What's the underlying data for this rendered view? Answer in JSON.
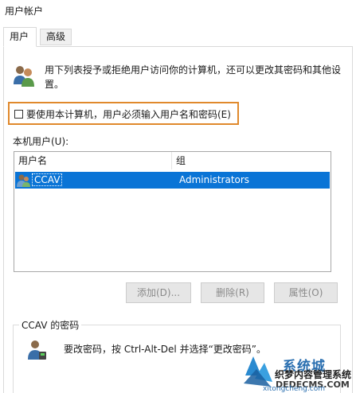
{
  "window": {
    "title": "用户帐户"
  },
  "tabs": [
    {
      "label": "用户"
    },
    {
      "label": "高级"
    }
  ],
  "description": "用下列表授予或拒绝用户访问你的计算机，还可以更改其密码和其他设置。",
  "require_login_checkbox": {
    "label": "要使用本计算机，用户必须输入用户名和密码(E)",
    "checked": false
  },
  "users_list": {
    "label": "本机用户(U):",
    "columns": [
      "用户名",
      "组"
    ],
    "rows": [
      {
        "name": "CCAV",
        "group": "Administrators",
        "selected": true
      }
    ]
  },
  "buttons": {
    "add": "添加(D)...",
    "remove": "删除(R)",
    "properties": "属性(O)"
  },
  "password_group": {
    "title": "CCAV 的密码",
    "text": "要改密码，按 Ctrl-Alt-Del 并选择“更改密码”。"
  },
  "watermark": {
    "brand": "系统城",
    "line1": "织梦内容管理系统",
    "line2": "DEDECMS.COM",
    "line3": "xitongcheng.com"
  },
  "colors": {
    "selection": "#0a74d6",
    "highlight_border": "#e0892c"
  }
}
